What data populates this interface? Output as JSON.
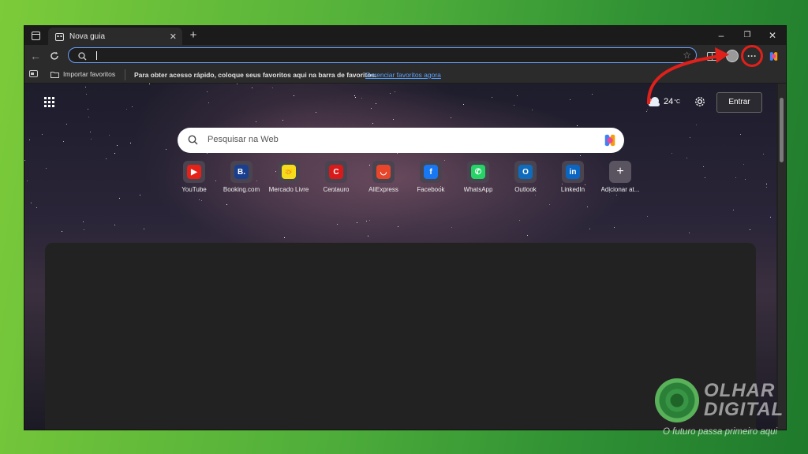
{
  "window": {
    "tab_title": "Nova guia",
    "new_tab": "+",
    "minimize": "–",
    "restore": "❐",
    "close": "✕"
  },
  "address_bar": {
    "value": "",
    "placeholder": ""
  },
  "favorites_bar": {
    "import_label": "Importar favoritos",
    "hint": "Para obter acesso rápido, coloque seus favoritos aqui na barra de favoritos.",
    "manage_link": "Gerenciar favoritos agora"
  },
  "ntp": {
    "weather_temp": "24",
    "weather_unit": "°C",
    "signin_label": "Entrar",
    "search_placeholder": "Pesquisar na Web",
    "tiles": [
      {
        "label": "YouTube",
        "icon": "youtube-icon",
        "color": "#e62117",
        "glyph": "▶"
      },
      {
        "label": "Booking.com",
        "icon": "booking-icon",
        "color": "#1a3f8f",
        "glyph": "B."
      },
      {
        "label": "Mercado Livre",
        "icon": "mercado-livre-icon",
        "color": "#f5dc1a",
        "glyph": "🤝"
      },
      {
        "label": "Centauro",
        "icon": "centauro-icon",
        "color": "#d91a1a",
        "glyph": "C"
      },
      {
        "label": "AliExpress",
        "icon": "aliexpress-icon",
        "color": "#e8462b",
        "glyph": "◡"
      },
      {
        "label": "Facebook",
        "icon": "facebook-icon",
        "color": "#1877f2",
        "glyph": "f"
      },
      {
        "label": "WhatsApp",
        "icon": "whatsapp-icon",
        "color": "#25d366",
        "glyph": "✆"
      },
      {
        "label": "Outlook",
        "icon": "outlook-icon",
        "color": "#0f6cbd",
        "glyph": "O"
      },
      {
        "label": "LinkedIn",
        "icon": "linkedin-icon",
        "color": "#0a66c2",
        "glyph": "in"
      },
      {
        "label": "Adicionar at...",
        "icon": "add-shortcut-icon",
        "color": "#6a6470",
        "glyph": "+"
      }
    ]
  },
  "watermark": {
    "line1": "OLHAR",
    "line2": "DIGITAL",
    "tagline": "O futuro passa primeiro aqui"
  },
  "colors": {
    "accent": "#6aa0ff",
    "highlight_ring": "#e0201a",
    "background_green": "#4fae3a"
  }
}
